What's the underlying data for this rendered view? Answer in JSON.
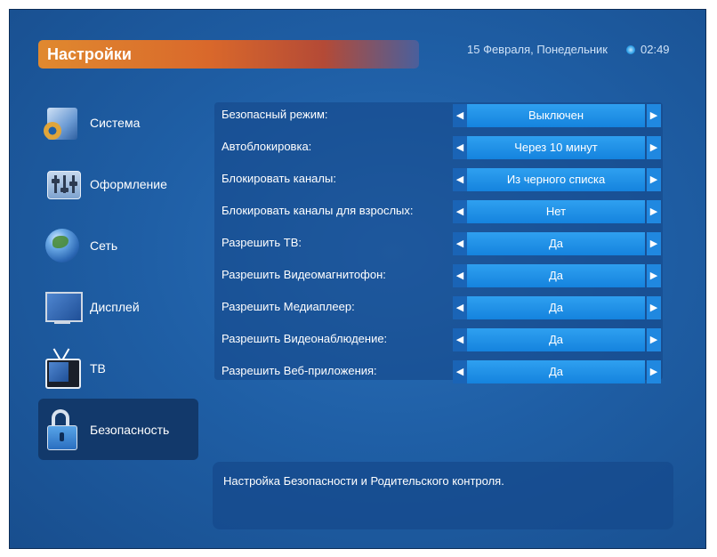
{
  "header": {
    "title": "Настройки",
    "date": "15 Февраля, Понедельник",
    "time": "02:49"
  },
  "sidebar": {
    "items": [
      {
        "label": "Система",
        "icon": "system-gear-icon"
      },
      {
        "label": "Оформление",
        "icon": "design-sliders-icon"
      },
      {
        "label": "Сеть",
        "icon": "network-globe-icon"
      },
      {
        "label": "Дисплей",
        "icon": "display-monitor-icon"
      },
      {
        "label": "ТВ",
        "icon": "tv-icon"
      },
      {
        "label": "Безопасность",
        "icon": "lock-icon",
        "selected": true
      }
    ]
  },
  "settings": {
    "rows": [
      {
        "label": "Безопасный режим:",
        "value": "Выключен"
      },
      {
        "label": "Автоблокировка:",
        "value": "Через 10 минут"
      },
      {
        "label": "Блокировать каналы:",
        "value": "Из черного списка"
      },
      {
        "label": "Блокировать каналы для взрослых:",
        "value": "Нет"
      },
      {
        "label": "Разрешить ТВ:",
        "value": "Да"
      },
      {
        "label": "Разрешить Видеомагнитофон:",
        "value": "Да"
      },
      {
        "label": "Разрешить Медиаплеер:",
        "value": "Да"
      },
      {
        "label": "Разрешить Видеонаблюдение:",
        "value": "Да"
      },
      {
        "label": "Разрешить Веб-приложения:",
        "value": "Да"
      }
    ],
    "arrow_left": "◀",
    "arrow_right": "▶"
  },
  "description": {
    "text": "Настройка Безопасности и Родительского контроля."
  },
  "colors": {
    "background": "#1f5fa6",
    "title_gradient_start": "#e0892f",
    "selector_fill": "#1583de",
    "sidebar_selected": "#12396b"
  }
}
